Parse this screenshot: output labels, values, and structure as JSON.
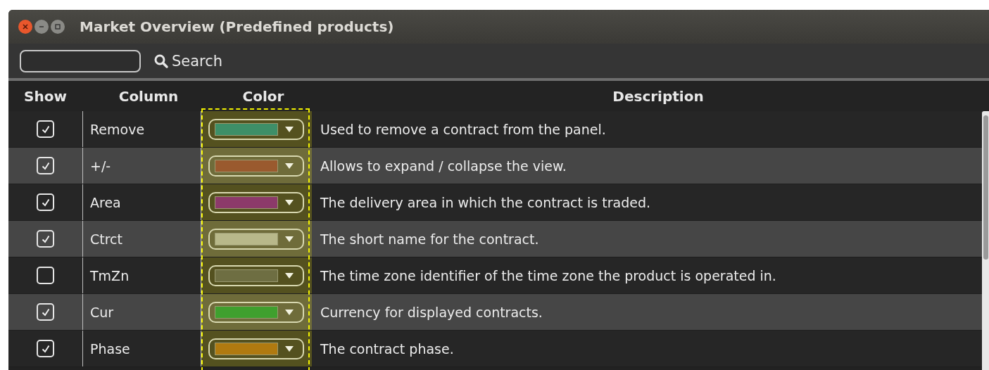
{
  "window": {
    "title": "Market Overview (Predefined products)"
  },
  "search": {
    "label": "Search"
  },
  "table": {
    "columns": [
      "Show",
      "Column",
      "Color",
      "Description"
    ],
    "rows": [
      {
        "show": true,
        "column": "Remove",
        "color": "#3e8f68",
        "description": "Used to remove a contract from the panel."
      },
      {
        "show": true,
        "column": "+/-",
        "color": "#9a5a2e",
        "description": "Allows to expand / collapse the view."
      },
      {
        "show": true,
        "column": "Area",
        "color": "#8c3a6a",
        "description": "The delivery area in which the contract is traded."
      },
      {
        "show": true,
        "column": "Ctrct",
        "color": "#b8b88a",
        "description": "The short name for the contract."
      },
      {
        "show": false,
        "column": "TmZn",
        "color": "#6e6e42",
        "description": "The time zone identifier of the time zone the product is operated in."
      },
      {
        "show": true,
        "column": "Cur",
        "color": "#3fa02e",
        "description": "Currency for displayed contracts."
      },
      {
        "show": true,
        "column": "Phase",
        "color": "#b07a10",
        "description": "The contract phase."
      }
    ]
  }
}
